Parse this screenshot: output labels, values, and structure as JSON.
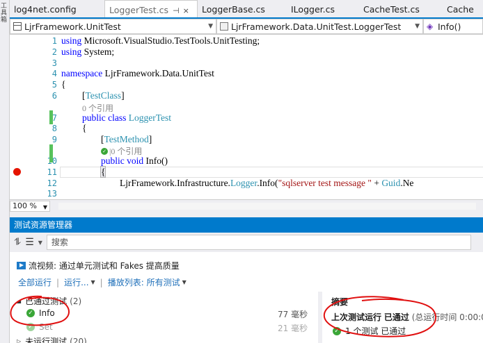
{
  "left_strip": {
    "text": "工具箱"
  },
  "tabs": [
    {
      "label": "log4net.config",
      "active": false
    },
    {
      "label": "LoggerTest.cs",
      "active": true
    },
    {
      "label": "LoggerBase.cs",
      "active": false
    },
    {
      "label": "ILogger.cs",
      "active": false
    },
    {
      "label": "CacheTest.cs",
      "active": false
    },
    {
      "label": "Cache",
      "active": false
    }
  ],
  "tab_controls": {
    "pin": "⊣",
    "close": "×"
  },
  "navbar": {
    "project": "LjrFramework.UnitTest",
    "type": "LjrFramework.Data.UnitTest.LoggerTest",
    "member": "Info()"
  },
  "editor": {
    "line_numbers": [
      "1",
      "2",
      "3",
      "4",
      "5",
      "6",
      "",
      "7",
      "8",
      "9",
      "",
      "10",
      "11",
      "12",
      "13"
    ],
    "lines": {
      "l1_kw": "using",
      "l1_rest": " Microsoft.VisualStudio.TestTools.UnitTesting;",
      "l2_kw": "using",
      "l2_rest": " System;",
      "l4_kw": "namespace",
      "l4_rest": " LjrFramework.Data.UnitTest",
      "l5": "{",
      "l6_open": "[",
      "l6_attr": "TestClass",
      "l6_close": "]",
      "codelens_class": "0 个引用",
      "l7_kw1": "public",
      "l7_kw2": "class",
      "l7_type": "LoggerTest",
      "l8": "{",
      "l9_open": "[",
      "l9_attr": "TestMethod",
      "l9_close": "]",
      "codelens_method": "|0 个引用",
      "l10_kw1": "public",
      "l10_kw2": "void",
      "l10_name": " Info()",
      "l11": "{",
      "l12_a": "LjrFramework.Infrastructure.",
      "l12_type": "Logger",
      "l12_b": ".Info(",
      "l12_str": "\"sqlserver test message \"",
      "l12_c": " + ",
      "l12_type2": "Guid",
      "l12_d": ".Ne"
    }
  },
  "zoom": "100 %",
  "test_explorer": {
    "title": "测试资源管理器",
    "search_placeholder": "搜索",
    "promo": "流视频: 通过单元测试和 Fakes 提高质量",
    "actions": {
      "run_all": "全部运行",
      "run": "运行...",
      "playlist": "播放列表: 所有测试"
    },
    "groups": [
      {
        "name": "已通过测试",
        "count": "(2)"
      },
      {
        "name": "未运行测试",
        "count": "(20)"
      }
    ],
    "tests": [
      {
        "name": "Info",
        "duration": "77 毫秒"
      },
      {
        "name": "Set",
        "duration": "21 毫秒"
      }
    ],
    "summary": {
      "heading": "摘要",
      "last_run_label": "上次测试运行",
      "last_run_status": "已通过",
      "last_run_time": "(总运行时间 0:00:0",
      "result": "1 个测试 已通过"
    }
  },
  "colors": {
    "accent": "#007acc",
    "pass": "#3aa637",
    "breakpoint": "#e51400",
    "annotation": "#e01010"
  }
}
